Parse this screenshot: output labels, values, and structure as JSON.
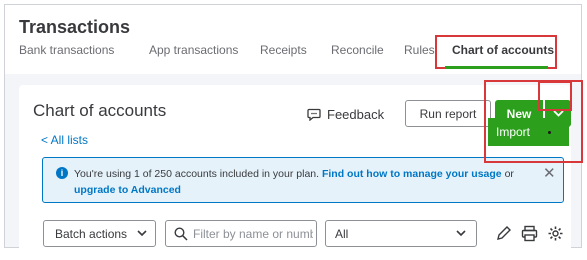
{
  "header": {
    "title": "Transactions",
    "tabs": [
      {
        "label": "Bank transactions"
      },
      {
        "label": "App transactions"
      },
      {
        "label": "Receipts"
      },
      {
        "label": "Reconcile"
      },
      {
        "label": "Rules"
      },
      {
        "label": "Chart of accounts"
      }
    ],
    "active_tab": "Chart of accounts"
  },
  "main": {
    "title": "Chart of accounts",
    "back_link": "< All lists",
    "feedback_label": "Feedback",
    "run_report_label": "Run report",
    "new_label": "New",
    "dropdown_items": [
      {
        "label": "Import"
      }
    ]
  },
  "banner": {
    "text_prefix": "You're using 1 of 250 accounts included in your plan.",
    "link1": "Find out how to manage your usage",
    "text_mid": "or",
    "link2": "upgrade to Advanced",
    "close": "✕"
  },
  "toolbar": {
    "batch_label": "Batch actions",
    "filter_placeholder": "Filter by name or number",
    "select_value": "All"
  },
  "colors": {
    "accent_green": "#2ca01c",
    "link_blue": "#0077c5",
    "highlight_red": "#d9383b"
  },
  "icons": [
    "feedback-icon",
    "chevron-down-icon",
    "info-icon",
    "close-icon",
    "search-icon",
    "edit-icon",
    "print-icon",
    "settings-icon"
  ]
}
